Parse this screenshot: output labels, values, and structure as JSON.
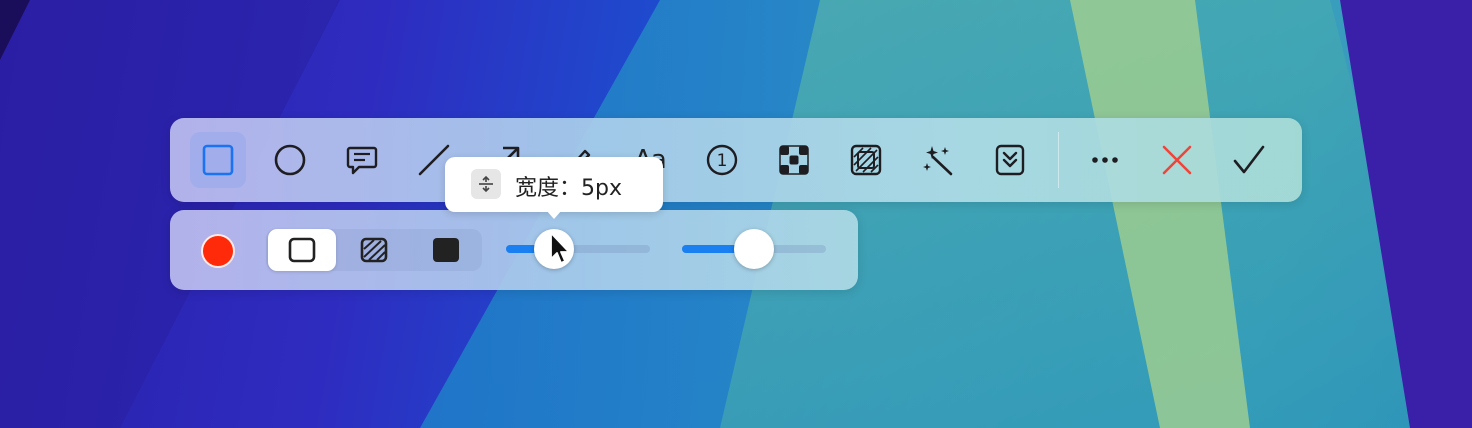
{
  "toolbar": {
    "tools": [
      {
        "name": "rectangle-tool",
        "icon": "square-icon",
        "active": true
      },
      {
        "name": "ellipse-tool",
        "icon": "circle-icon"
      },
      {
        "name": "callout-tool",
        "icon": "speech-bubble-icon"
      },
      {
        "name": "line-tool",
        "icon": "line-icon"
      },
      {
        "name": "arrow-tool",
        "icon": "arrow-icon"
      },
      {
        "name": "pen-tool",
        "icon": "pen-icon"
      },
      {
        "name": "text-tool",
        "icon": "text-icon",
        "label": "Aa"
      },
      {
        "name": "counter-tool",
        "icon": "number-one-circle-icon",
        "label": "1"
      },
      {
        "name": "mosaic-tool",
        "icon": "mosaic-icon"
      },
      {
        "name": "blur-tool",
        "icon": "blur-icon"
      },
      {
        "name": "magic-tool",
        "icon": "magic-wand-icon"
      },
      {
        "name": "scroll-capture-tool",
        "icon": "scroll-down-icon"
      },
      {
        "name": "more-tool",
        "icon": "more-icon"
      },
      {
        "name": "cancel-tool",
        "icon": "close-icon"
      },
      {
        "name": "confirm-tool",
        "icon": "check-icon"
      }
    ]
  },
  "subbar": {
    "color": "#ff2a0a",
    "fill_modes": [
      "outline",
      "hatched",
      "solid"
    ],
    "selected_fill": "outline",
    "width_slider": {
      "value_fraction": 0.33
    },
    "opacity_slider": {
      "value_fraction": 0.5
    }
  },
  "tooltip": {
    "text": "宽度：5px"
  },
  "colors": {
    "accent": "#1a7ff0",
    "cancel": "#f0443a",
    "selected_color": "#ff2a0a"
  }
}
